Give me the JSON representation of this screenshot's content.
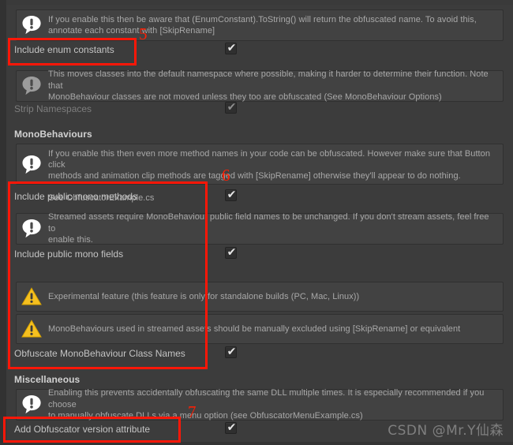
{
  "window": {
    "background_color": "#3c3c3c",
    "panel_color": "#424242",
    "accent_annotation_color": "#fd1708",
    "watermark": "CSDN @Mr.Y仙森"
  },
  "help_boxes": {
    "enum_constants": {
      "icon": "info-speech-bubble-icon",
      "text": "If you enable this then be aware that (EnumConstant).ToString() will return the obfuscated name. To avoid this,\nannotate each constant with [SkipRename]"
    },
    "strip_namespaces": {
      "icon": "info-speech-bubble-icon",
      "text": "This moves classes into the default namespace where possible, making it harder to determine their function. Note that\nMonoBehaviour classes are not moved unless they too are obfuscated (See MonoBehaviour Options)"
    },
    "public_mono_methods": {
      "icon": "info-speech-bubble-icon",
      "text": "If you enable this then even more method names in your code can be obfuscated. However make sure that Button click\nmethods and animation clip methods are tagged with [SkipRename] otherwise they'll appear to do nothing.\n\nSee ObfuscatorExample.cs"
    },
    "public_mono_fields": {
      "icon": "info-speech-bubble-icon",
      "text": "Streamed assets require MonoBehaviour public field names to be unchanged. If you don't stream assets, feel free to\nenable this."
    },
    "experimental_warning": {
      "icon": "warning-triangle-icon",
      "text": "Experimental feature (this feature is only for standalone builds (PC, Mac, Linux))"
    },
    "streamed_assets_warning": {
      "icon": "warning-triangle-icon",
      "text": "MonoBehaviours used in streamed assets should be manually excluded using [SkipRename] or equivalent"
    },
    "version_attribute": {
      "icon": "info-speech-bubble-icon",
      "text": "Enabling this prevents accidentally obfuscating the same DLL multiple times. It is especially recommended if you choose\nto manually obfuscate DLLs via a menu option (see ObfuscatorMenuExample.cs)"
    }
  },
  "sections": {
    "monobehaviours_title": "MonoBehaviours",
    "miscellaneous_title": "Miscellaneous"
  },
  "settings": [
    {
      "key": "include_enum_constants",
      "label": "Include enum constants",
      "checked": true,
      "disabled": false
    },
    {
      "key": "strip_namespaces",
      "label": "Strip Namespaces",
      "checked": true,
      "disabled": true
    },
    {
      "key": "include_public_mono_methods",
      "label": "Include public mono methods",
      "checked": true,
      "disabled": false
    },
    {
      "key": "include_public_mono_fields",
      "label": "Include public mono fields",
      "checked": true,
      "disabled": false
    },
    {
      "key": "obfuscate_mono_class_names",
      "label": "Obfuscate MonoBehaviour Class Names",
      "checked": true,
      "disabled": false
    },
    {
      "key": "add_obfuscator_version_attribute",
      "label": "Add Obfuscator version attribute",
      "checked": true,
      "disabled": false
    }
  ],
  "checkbox_glyph": "✔",
  "annotations": {
    "numbers": [
      {
        "label": "5",
        "target": "include-enum-constants"
      },
      {
        "label": "6",
        "target": "include-public-mono-methods-group"
      },
      {
        "label": "7",
        "target": "add-obfuscator-version-attribute"
      }
    ]
  }
}
